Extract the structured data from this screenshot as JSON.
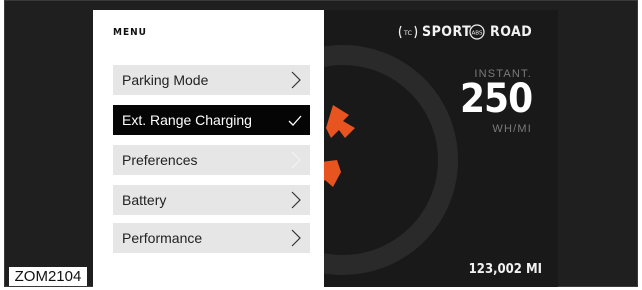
{
  "menu": {
    "title": "MENU",
    "items": [
      {
        "label": "Parking Mode",
        "state": "normal",
        "indicator": "chevron-right-icon"
      },
      {
        "label": "Ext. Range Charging",
        "state": "selected",
        "indicator": "checkmark-icon"
      },
      {
        "label": "Preferences",
        "state": "disabled",
        "indicator": "chevron-right-icon"
      },
      {
        "label": "Battery",
        "state": "normal",
        "indicator": "chevron-right-icon"
      },
      {
        "label": "Performance",
        "state": "normal",
        "indicator": "chevron-right-icon"
      }
    ]
  },
  "status": {
    "tc_icon": "traction-control-icon",
    "tc_badge": "TC",
    "mode": "SPORT",
    "abs_icon": "abs-icon",
    "abs_badge": "ABS",
    "ride": "ROAD"
  },
  "efficiency": {
    "label": "INSTANT.",
    "value": "250",
    "unit": "WH/MI"
  },
  "odometer": "123,002 MI",
  "figure_id": "ZOM2104",
  "colors": {
    "accent_orange": "#e8541f",
    "screen_bg": "#191919",
    "frame_bg": "#1f1f1f",
    "menu_item_bg": "#e6e6e6",
    "menu_item_selected_bg": "#050505"
  }
}
